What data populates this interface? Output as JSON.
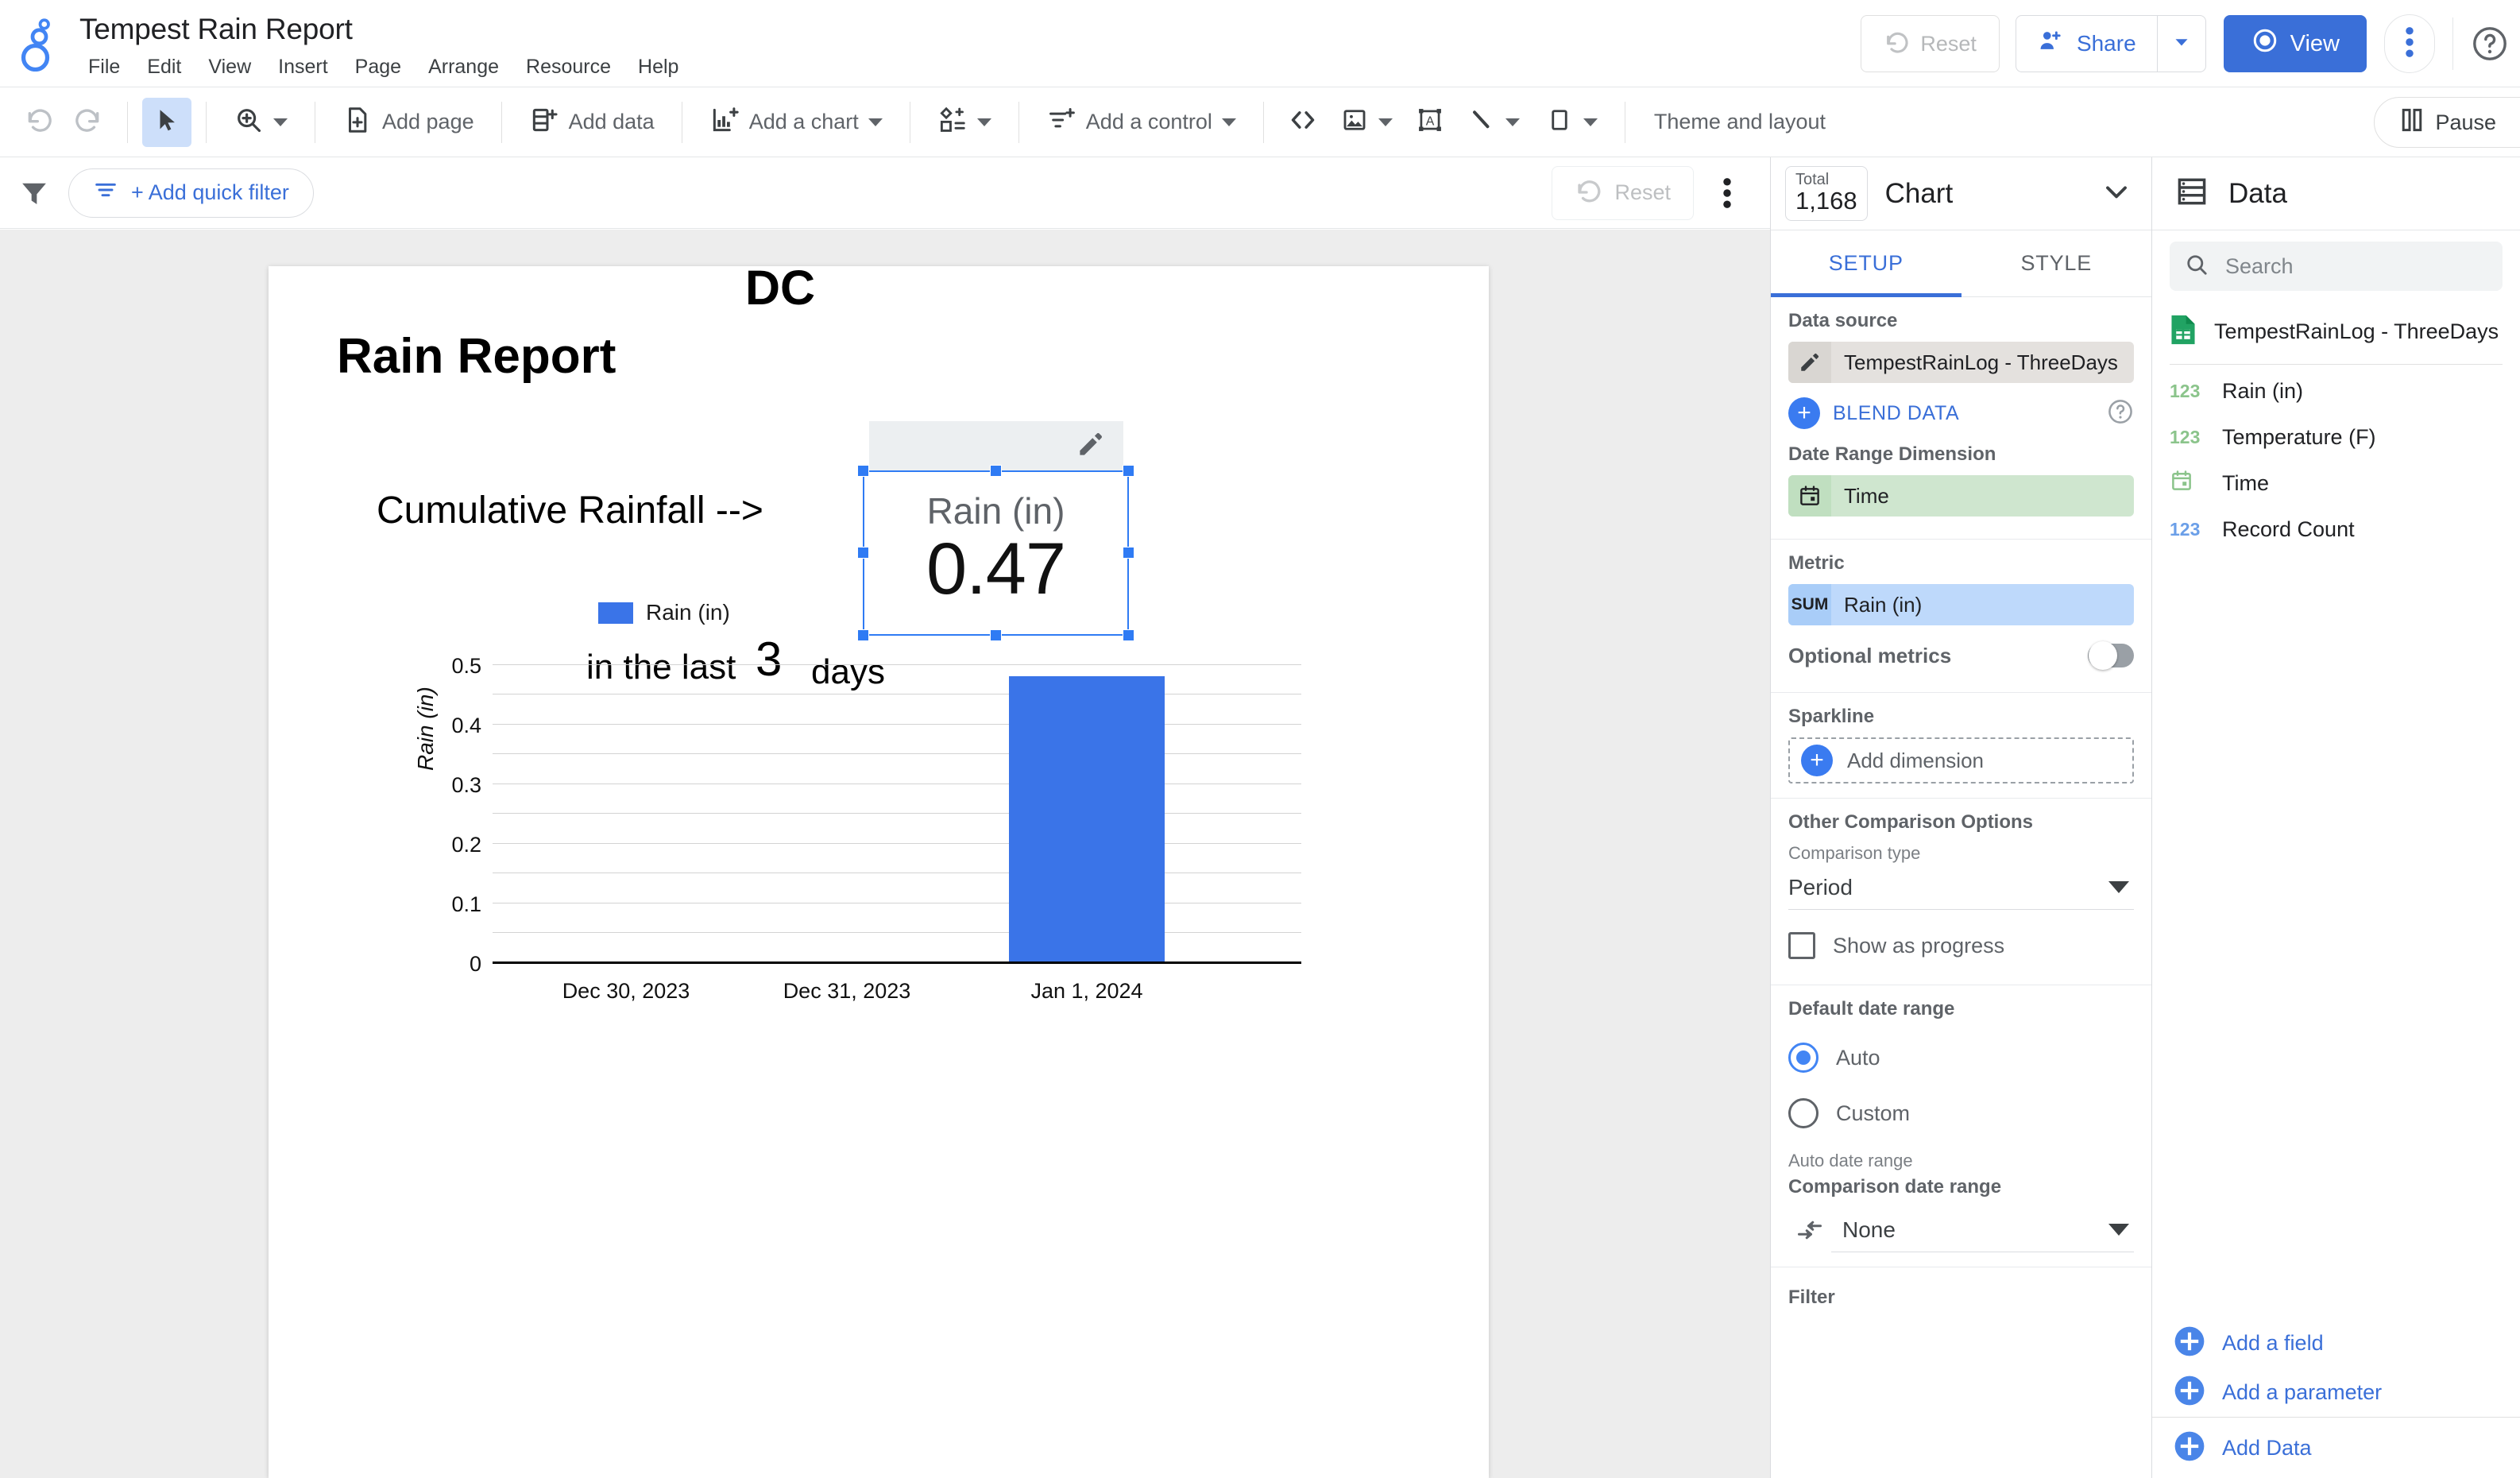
{
  "header": {
    "doc_title": "Tempest Rain Report",
    "logo_icon": "looker-studio-logo-icon",
    "menus": [
      "File",
      "Edit",
      "View",
      "Insert",
      "Page",
      "Arrange",
      "Resource",
      "Help"
    ],
    "reset_label": "Reset",
    "share_label": "Share",
    "view_label": "View",
    "kebab_icon": "more-vertical-icon",
    "help_icon": "help-circle-icon"
  },
  "toolbar": {
    "undo_icon": "undo-icon",
    "redo_icon": "redo-icon",
    "select_icon": "cursor-arrow-icon",
    "zoom_icon": "magnifier-plus-icon",
    "add_page": "Add page",
    "add_data": "Add data",
    "add_chart": "Add a chart",
    "community_viz_icon": "community-visualization-icon",
    "add_control": "Add a control",
    "embed_icon": "embed-code-icon",
    "image_icon": "image-icon",
    "text_icon": "text-box-icon",
    "line_icon": "line-icon",
    "shape_icon": "rectangle-shape-icon",
    "theme_and_layout": "Theme and layout",
    "pause_label": "Pause",
    "pause_icon": "pause-icon"
  },
  "filterbar": {
    "filter_icon": "funnel-icon",
    "add_quick_filter": "+ Add quick filter",
    "quick_filter_icon": "filter-lines-icon",
    "reset_label": "Reset",
    "kebab_icon": "more-vertical-icon"
  },
  "report": {
    "dc": "DC",
    "title": "Rain Report",
    "cumulative_label": "Cumulative Rainfall -->",
    "in_the_last": "in the last",
    "days_number": "3",
    "days_label": "days",
    "scorecard": {
      "metric_label": "Rain (in)",
      "value": "0.47",
      "edit_icon": "pencil-edit-icon",
      "selected": true
    }
  },
  "chart_data": {
    "type": "bar",
    "title": "",
    "categories": [
      "Dec 30, 2023",
      "Dec 31, 2023",
      "Jan 1, 2024"
    ],
    "values": [
      0,
      0,
      0.47
    ],
    "series": [
      {
        "name": "Rain (in)",
        "values": [
          0,
          0,
          0.47
        ],
        "color": "#3a74e8"
      }
    ],
    "legend": [
      "Rain (in)"
    ],
    "legend_position": "top-left",
    "xlabel": "",
    "ylabel": "Rain (in)",
    "ylim": [
      0,
      0.5
    ],
    "yticks": [
      "0",
      "0.1",
      "0.2",
      "0.3",
      "0.4",
      "0.5"
    ],
    "ytick_values": [
      0,
      0.1,
      0.2,
      0.3,
      0.4,
      0.5
    ],
    "minor_gridlines": true,
    "grid": true
  },
  "properties": {
    "total_chip_label": "Total",
    "total_chip_value": "1,168",
    "panel_title": "Chart",
    "collapse_icon": "chevron-down-icon",
    "tabs": [
      {
        "label": "SETUP",
        "active": true
      },
      {
        "label": "STYLE",
        "active": false
      }
    ],
    "data_source": {
      "section_title": "Data source",
      "name": "TempestRainLog - ThreeDays",
      "edit_icon": "pencil-icon",
      "blend_data": "BLEND DATA",
      "help_icon": "help-circle-icon"
    },
    "date_range_dimension": {
      "section_title": "Date Range Dimension",
      "value": "Time",
      "icon": "calendar-icon"
    },
    "metric": {
      "section_title": "Metric",
      "agg": "SUM",
      "field": "Rain (in)",
      "optional_metrics_label": "Optional metrics",
      "optional_metrics_on": false
    },
    "sparkline": {
      "section_title": "Sparkline",
      "add_dimension": "Add dimension"
    },
    "other_comparison": {
      "section_title": "Other Comparison Options",
      "comparison_type_label": "Comparison type",
      "comparison_type_value": "Period",
      "show_as_progress": "Show as progress",
      "show_as_progress_checked": false
    },
    "default_date_range": {
      "section_title": "Default date range",
      "options": [
        "Auto",
        "Custom"
      ],
      "selected": "Auto",
      "auto_date_range_label": "Auto date range",
      "comparison_date_range_label": "Comparison date range",
      "comparison_date_range_value": "None",
      "comparison_icon": "compare-arrows-icon"
    },
    "filter_section_title": "Filter"
  },
  "data_panel": {
    "title": "Data",
    "title_icon": "data-list-icon",
    "search_placeholder": "Search",
    "search_value": "",
    "search_icon": "search-icon",
    "source_name": "TempestRainLog - ThreeDays",
    "source_icon": "google-sheets-icon",
    "fields": [
      {
        "name": "Rain (in)",
        "type_icon": "123",
        "kind": "metric"
      },
      {
        "name": "Temperature (F)",
        "type_icon": "123",
        "kind": "metric"
      },
      {
        "name": "Time",
        "type_icon": "calendar-icon",
        "kind": "dimension"
      },
      {
        "name": "Record Count",
        "type_icon": "123",
        "kind": "metric-blue"
      }
    ],
    "add_a_field": "Add a field",
    "add_a_parameter": "Add a parameter",
    "add_data": "Add Data"
  },
  "colors": {
    "accent_blue": "#3a6fd8",
    "bar_blue": "#3a74e8",
    "selection_blue": "#2f7bf4",
    "metric_chip": "#bed9fb",
    "dimension_chip": "#cfe6cf",
    "source_chip": "#e4e1de"
  }
}
